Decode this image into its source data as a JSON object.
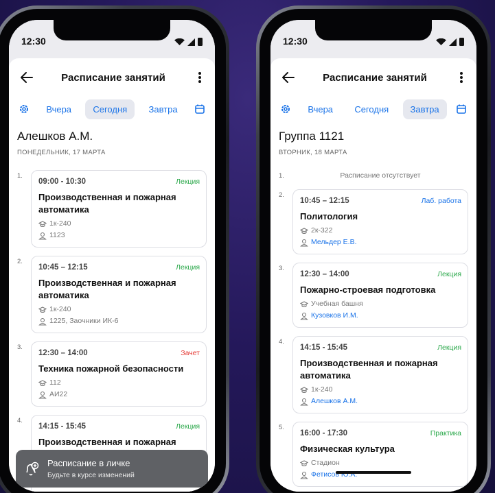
{
  "colors": {
    "accent": "#1a73e8",
    "lecture": "#2aa84a",
    "exam": "#e53935"
  },
  "phones": [
    {
      "status_time": "12:30",
      "title": "Расписание занятий",
      "tabs": [
        {
          "label": "Вчера",
          "active": false
        },
        {
          "label": "Сегодня",
          "active": true
        },
        {
          "label": "Завтра",
          "active": false
        }
      ],
      "heading": "Алешков А.М.",
      "date": "ПОНЕДЕЛЬНИК, 17 МАРТА",
      "lessons": [
        {
          "number": "1.",
          "time": "09:00 - 10:30",
          "type": "Лекция",
          "type_color": "green",
          "title": "Производственная и пожарная автоматика",
          "room": "1к-240",
          "who": "1123",
          "who_link": false
        },
        {
          "number": "2.",
          "time": "10:45 – 12:15",
          "type": "Лекция",
          "type_color": "green",
          "title": "Производственная и пожарная автоматика",
          "room": "1к-240",
          "who": "1225, Заочники ИК-6",
          "who_link": false
        },
        {
          "number": "3.",
          "time": "12:30 – 14:00",
          "type": "Зачет",
          "type_color": "red",
          "title": "Техника пожарной безопасности",
          "room": "112",
          "who": "АИ22",
          "who_link": false
        },
        {
          "number": "4.",
          "time": "14:15 - 15:45",
          "type": "Лекция",
          "type_color": "green",
          "title": "Производственная и пожарная",
          "room": "",
          "who": "",
          "who_link": false
        }
      ],
      "toast": {
        "title": "Расписание в личке",
        "subtitle": "Будьте в курсе изменений",
        "icon": "bell-plus-icon"
      }
    },
    {
      "status_time": "12:30",
      "title": "Расписание занятий",
      "tabs": [
        {
          "label": "Вчера",
          "active": false
        },
        {
          "label": "Сегодня",
          "active": false
        },
        {
          "label": "Завтра",
          "active": true
        }
      ],
      "heading": "Группа 1121",
      "date": "ВТОРНИК, 18 МАРТА",
      "absent": {
        "number": "1.",
        "text": "Расписание отсутствует"
      },
      "lessons": [
        {
          "number": "2.",
          "time": "10:45 – 12:15",
          "type": "Лаб. работа",
          "type_color": "blue",
          "title": "Политология",
          "room": "2к-322",
          "who": "Мельдер Е.В.",
          "who_link": true
        },
        {
          "number": "3.",
          "time": "12:30 – 14:00",
          "type": "Лекция",
          "type_color": "green",
          "title": "Пожарно-строевая подготовка",
          "room": "Учебная башня",
          "who": "Кузовков И.М.",
          "who_link": true
        },
        {
          "number": "4.",
          "time": "14:15 - 15:45",
          "type": "Лекция",
          "type_color": "green",
          "title": "Производственная и пожарная автоматика",
          "room": "1к-240",
          "who": "Алешков А.М.",
          "who_link": true
        },
        {
          "number": "5.",
          "time": "16:00 - 17:30",
          "type": "Практика",
          "type_color": "green",
          "title": "Физическая культура",
          "room": "Стадион",
          "who": "Фетисов Ю.А.",
          "who_link": true
        }
      ]
    }
  ]
}
